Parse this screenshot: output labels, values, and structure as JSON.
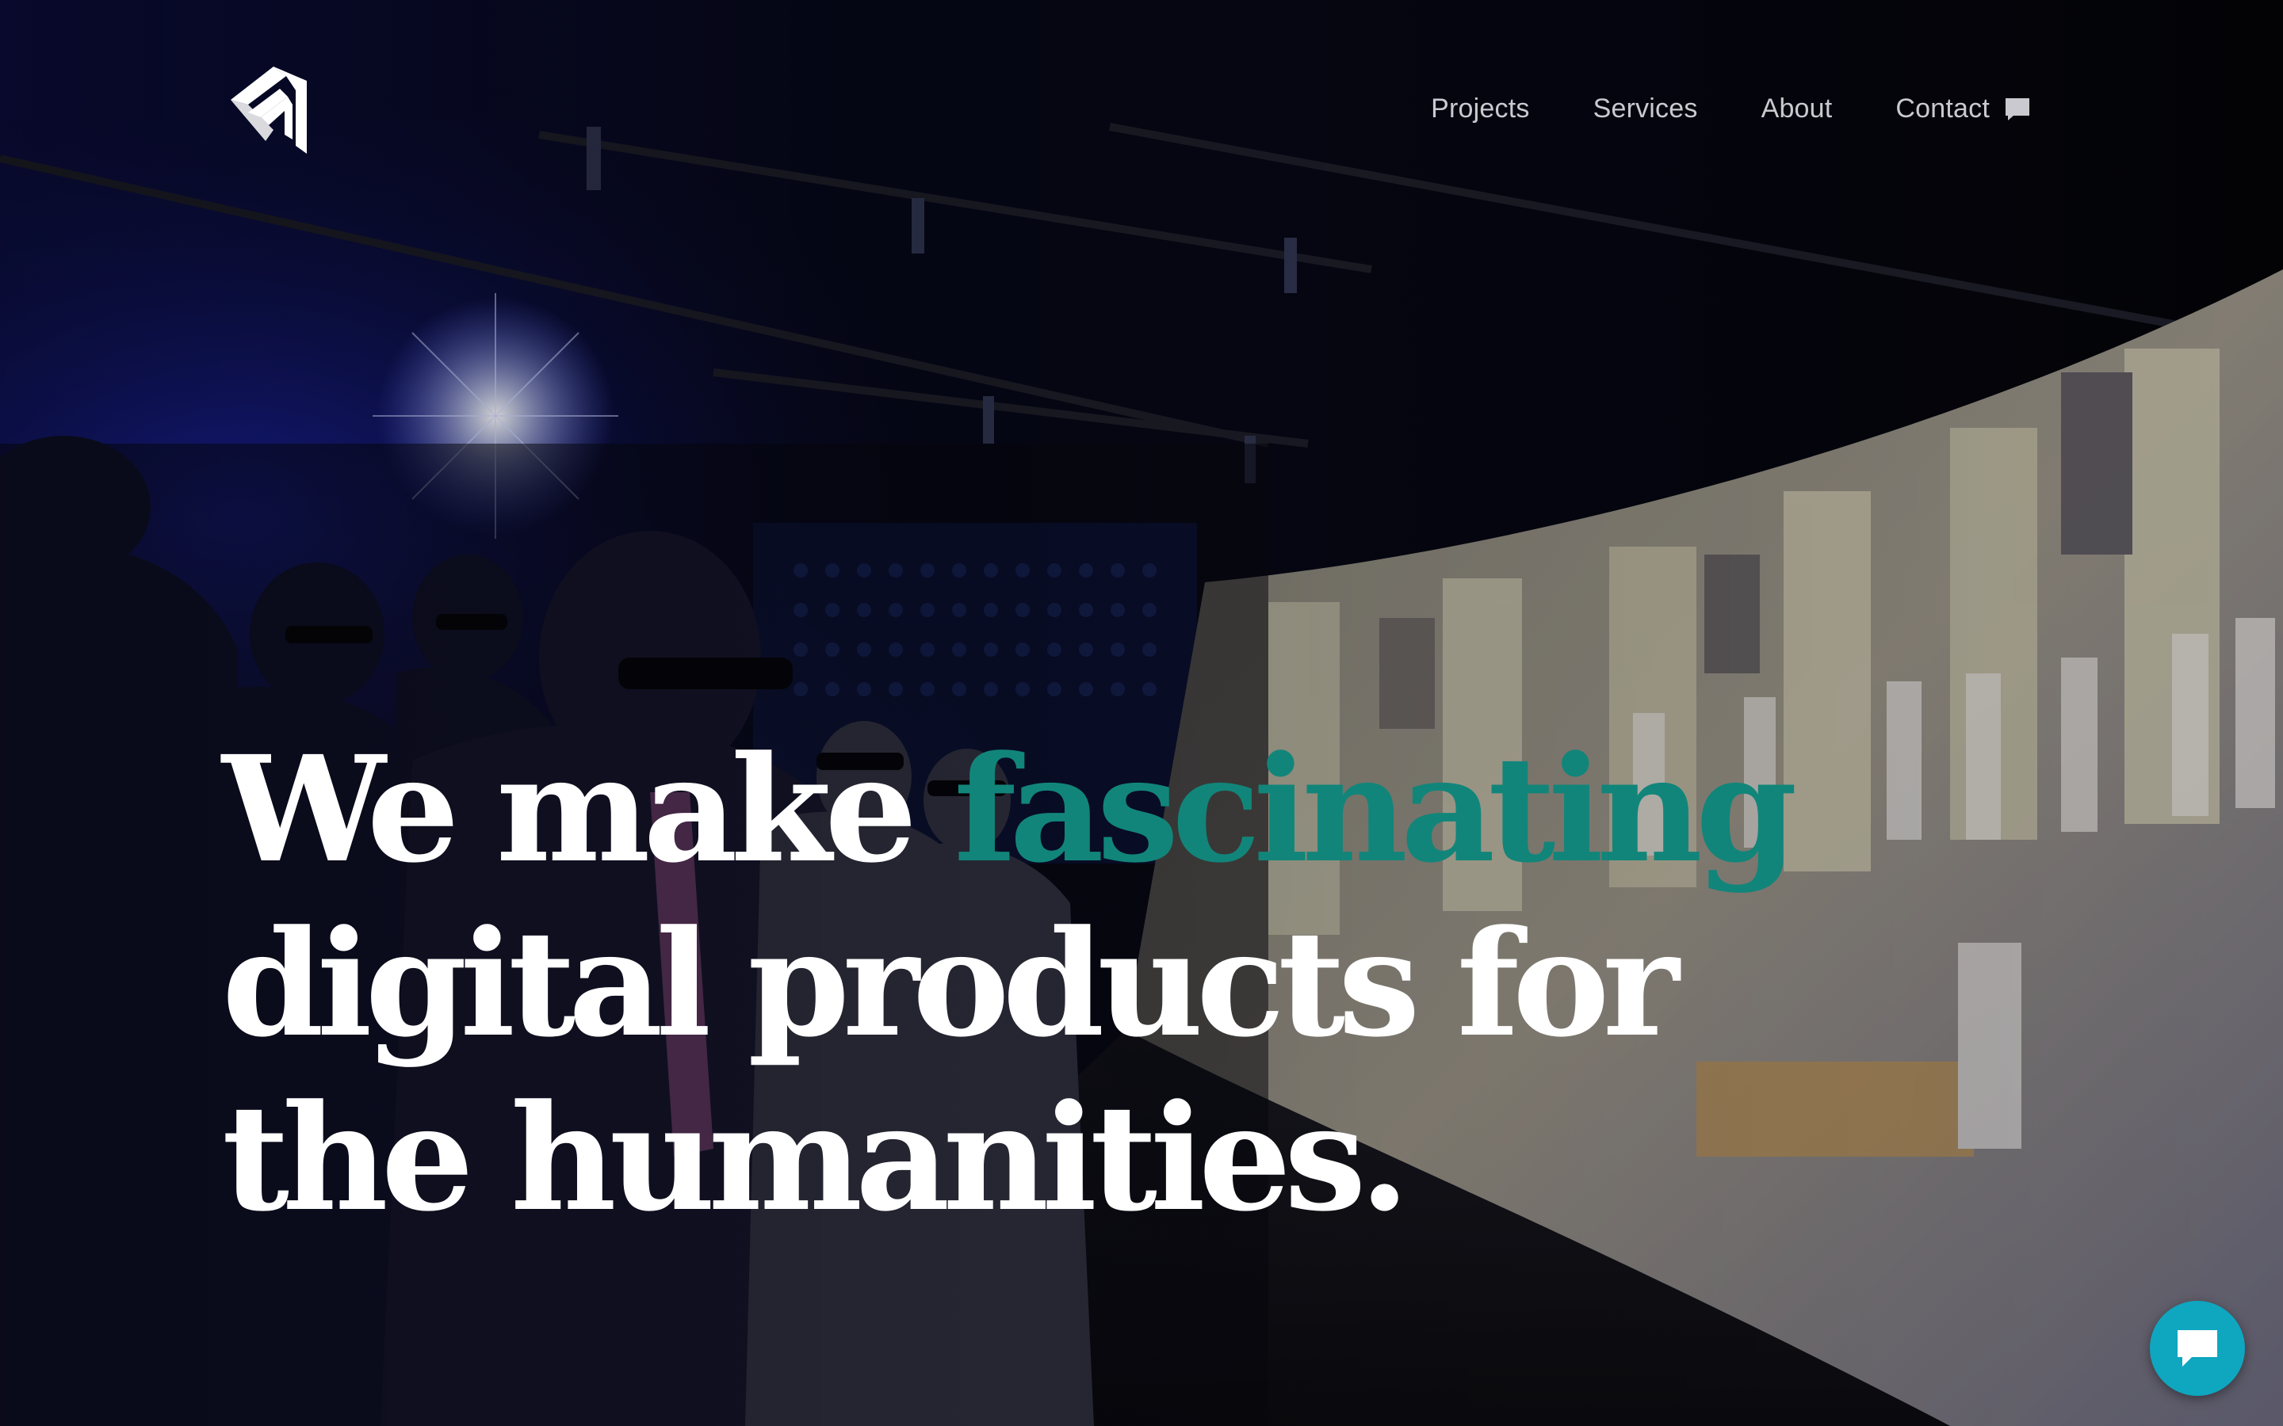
{
  "header": {
    "logo_icon": "studio-logo-icon",
    "nav": [
      {
        "label": "Projects"
      },
      {
        "label": "Services"
      },
      {
        "label": "About"
      },
      {
        "label": "Contact",
        "icon": "chat-bubble-icon"
      }
    ]
  },
  "hero": {
    "headline": {
      "line1_prefix": "We make ",
      "line1_accent": "fascinating",
      "line2": "digital products for",
      "line3": "the humanities."
    },
    "colors": {
      "headline": "#ffffff",
      "accent": "#12857a"
    }
  },
  "chat_widget": {
    "icon": "chat-bubble-icon",
    "color": "#0fa6c0"
  }
}
